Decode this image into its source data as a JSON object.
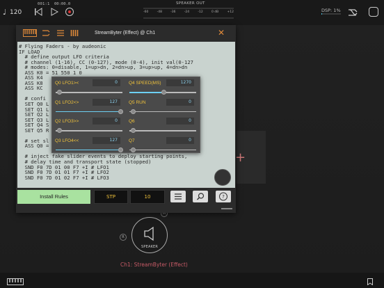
{
  "transport": {
    "tempo": "120",
    "position": "001:1",
    "time": "00:00.0",
    "speaker_out_label": "SPEAKER OUT",
    "meter_scale": [
      "-60",
      "-48",
      "-36",
      "-24",
      "-12",
      "0 dB",
      "+12"
    ],
    "dsp_label": "DSP: 1%"
  },
  "window": {
    "title": "StreamByter (Effect) @ Ch1",
    "close_glyph": "✕",
    "code": "# Flying Faders - by audeonic\nIF LOAD\n  # define output LFO criteria\n  # channel (1-16), CC (0-127), mode (0-4), init val(0-127\n  # modes: 0=disable, 1=up>dn, 2=dn>up, 3=up>up, 4=dn>dn\n  ASS K0 = 51 550 1 0\n  ASS K4\n  ASS K8\n  ASS KC\n\n  # confi\n  SET Q0 L\n  SET Q1 L\n  SET Q2 L\n  SET Q3 L\n  SET Q4 S\n  SET Q5 R\n\n  # set sl\n  ASS Q0 = \n\n  # inject fake slider events to deploy starting points,\n  # delay time and transport state (stopped)\n  SND F0 7D 01 00 F7 +I # LFO1\n  SND F0 7D 01 01 F7 +I # LFO2\n  SND F0 7D 01 02 F7 +I # LFO3",
    "install_label": "Install Rules",
    "stp_label": "STP",
    "num_value": "10"
  },
  "sliders": [
    {
      "label": "Q0 LFO1><",
      "value": "0",
      "level": 0.0
    },
    {
      "label": "Q4 SPEED(MS)",
      "value": "1270",
      "level": 0.5
    },
    {
      "label": "Q1 LFO2<>",
      "value": "127",
      "level": 1.0
    },
    {
      "label": "Q5 RUN",
      "value": "0",
      "level": 0.0
    },
    {
      "label": "Q2 LFO3>>",
      "value": "0",
      "level": 0.0
    },
    {
      "label": "Q6",
      "value": "0",
      "level": 0.0
    },
    {
      "label": "Q3 LFO4<<",
      "value": "127",
      "level": 1.0
    },
    {
      "label": "Q7",
      "value": "0",
      "level": 0.0
    }
  ],
  "graph": {
    "node_label": "SPEAKER",
    "node_name": "Ch1: StreamByter (Effect)",
    "left_badge": "R",
    "top_badge": "M"
  },
  "colors": {
    "accent_orange": "#e08a3a",
    "slider_label": "#f0c23a",
    "slider_fill": "#6dd0f3",
    "install_green": "#a9e2a0",
    "node_name_red": "#c65a66"
  }
}
